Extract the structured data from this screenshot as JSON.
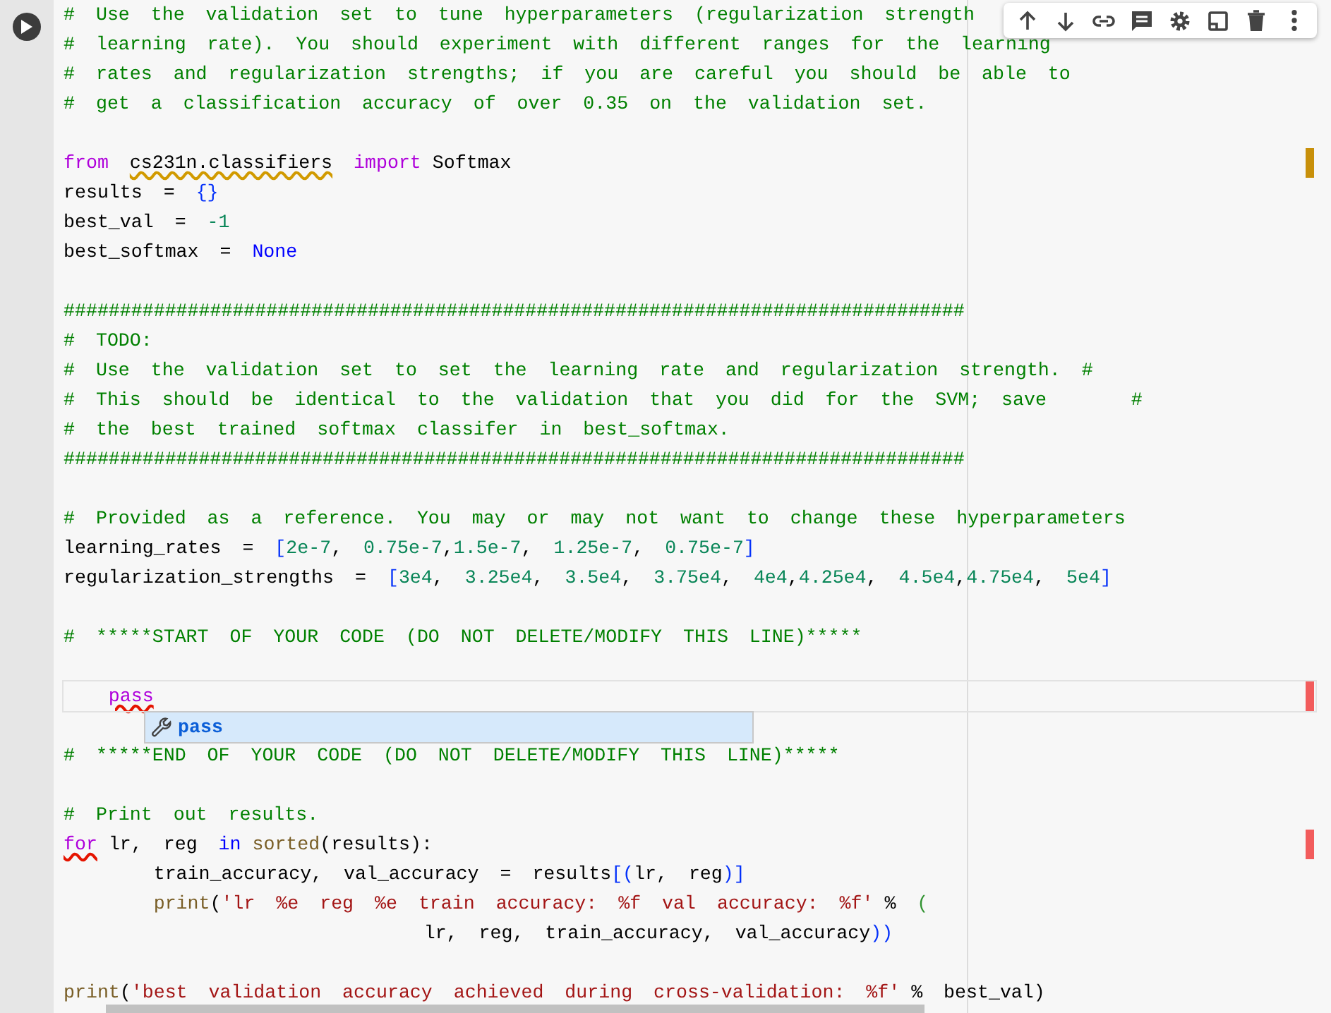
{
  "cell": {
    "lines": [
      {
        "kind": "code",
        "tokens": [
          {
            "t": "# Use the validation set to tune hyperparameters (regularization strength",
            "kind": "comment"
          }
        ]
      },
      {
        "kind": "code",
        "tokens": [
          {
            "t": "# learning rate). You should experiment with different ranges for the learning",
            "kind": "comment"
          }
        ]
      },
      {
        "kind": "code",
        "tokens": [
          {
            "t": "# rates and regularization strengths; if you are careful you should be able to",
            "kind": "comment"
          }
        ]
      },
      {
        "kind": "code",
        "tokens": [
          {
            "t": "# get a classification accuracy of over 0.35 on the validation set.",
            "kind": "comment"
          }
        ]
      },
      {
        "kind": "blank"
      },
      {
        "kind": "code",
        "marker": {
          "color": "#c8900a"
        },
        "tokens": [
          {
            "t": "from ",
            "kind": "keyword"
          },
          {
            "t": "cs231n.classifiers ",
            "kind": "plain",
            "squiggle": {
              "color": "#d19a00"
            }
          },
          {
            "t": "import",
            "kind": "keyword"
          },
          {
            "t": " Softmax",
            "kind": "plain"
          }
        ]
      },
      {
        "kind": "code",
        "tokens": [
          {
            "t": "results = ",
            "kind": "plain"
          },
          {
            "t": "{}",
            "kind": "bracket"
          }
        ]
      },
      {
        "kind": "code",
        "tokens": [
          {
            "t": "best_val = ",
            "kind": "plain"
          },
          {
            "t": "-1",
            "kind": "number"
          }
        ]
      },
      {
        "kind": "code",
        "tokens": [
          {
            "t": "best_softmax = ",
            "kind": "plain"
          },
          {
            "t": "None",
            "kind": "constant"
          }
        ]
      },
      {
        "kind": "blank"
      },
      {
        "kind": "code",
        "tokens": [
          {
            "t": "################################################################################",
            "kind": "comment"
          }
        ]
      },
      {
        "kind": "code",
        "tokens": [
          {
            "t": "# TODO:",
            "kind": "comment"
          }
        ]
      },
      {
        "kind": "code",
        "tokens": [
          {
            "t": "# Use the validation set to set the learning rate and regularization strength. #",
            "kind": "comment"
          }
        ]
      },
      {
        "kind": "code",
        "tokens": [
          {
            "t": "# This should be identical to the validation that you did for the SVM; save    #",
            "kind": "comment"
          }
        ]
      },
      {
        "kind": "code",
        "tokens": [
          {
            "t": "# the best trained softmax classifer in best_softmax.",
            "kind": "comment"
          }
        ]
      },
      {
        "kind": "code",
        "tokens": [
          {
            "t": "################################################################################",
            "kind": "comment"
          }
        ]
      },
      {
        "kind": "blank"
      },
      {
        "kind": "code",
        "tokens": [
          {
            "t": "# Provided as a reference. You may or may not want to change these hyperparameters",
            "kind": "comment"
          }
        ]
      },
      {
        "kind": "code",
        "tokens": [
          {
            "t": "learning_rates = ",
            "kind": "plain"
          },
          {
            "t": "[",
            "kind": "bracket"
          },
          {
            "t": "2e-7",
            "kind": "number"
          },
          {
            "t": ", ",
            "kind": "plain"
          },
          {
            "t": "0.75e-7",
            "kind": "number"
          },
          {
            "t": ",",
            "kind": "plain"
          },
          {
            "t": "1.5e-7",
            "kind": "number"
          },
          {
            "t": ", ",
            "kind": "plain"
          },
          {
            "t": "1.25e-7",
            "kind": "number"
          },
          {
            "t": ", ",
            "kind": "plain"
          },
          {
            "t": "0.75e-7",
            "kind": "number"
          },
          {
            "t": "]",
            "kind": "bracket"
          }
        ]
      },
      {
        "kind": "code",
        "tokens": [
          {
            "t": "regularization_strengths = ",
            "kind": "plain"
          },
          {
            "t": "[",
            "kind": "bracket"
          },
          {
            "t": "3e4",
            "kind": "number"
          },
          {
            "t": ", ",
            "kind": "plain"
          },
          {
            "t": "3.25e4",
            "kind": "number"
          },
          {
            "t": ", ",
            "kind": "plain"
          },
          {
            "t": "3.5e4",
            "kind": "number"
          },
          {
            "t": ", ",
            "kind": "plain"
          },
          {
            "t": "3.75e4",
            "kind": "number"
          },
          {
            "t": ", ",
            "kind": "plain"
          },
          {
            "t": "4e4",
            "kind": "number"
          },
          {
            "t": ",",
            "kind": "plain"
          },
          {
            "t": "4.25e4",
            "kind": "number"
          },
          {
            "t": ", ",
            "kind": "plain"
          },
          {
            "t": "4.5e4",
            "kind": "number"
          },
          {
            "t": ",",
            "kind": "plain"
          },
          {
            "t": "4.75e4",
            "kind": "number"
          },
          {
            "t": ", ",
            "kind": "plain"
          },
          {
            "t": "5e4",
            "kind": "number"
          },
          {
            "t": "]",
            "kind": "bracket"
          }
        ]
      },
      {
        "kind": "blank"
      },
      {
        "kind": "code",
        "tokens": [
          {
            "t": "# *****START OF YOUR CODE (DO NOT DELETE/MODIFY THIS LINE)*****",
            "kind": "comment"
          }
        ]
      },
      {
        "kind": "blank"
      },
      {
        "kind": "code",
        "current": true,
        "marker": {
          "color": "#f25c5c"
        },
        "tokens": [
          {
            "t": "    pass",
            "kind": "keyword",
            "squiggle": {
              "color": "#e51400"
            }
          }
        ]
      },
      {
        "kind": "blank"
      },
      {
        "kind": "code",
        "tokens": [
          {
            "t": "# *****END OF YOUR CODE (DO NOT DELETE/MODIFY THIS LINE)*****",
            "kind": "comment"
          }
        ]
      },
      {
        "kind": "blank"
      },
      {
        "kind": "code",
        "tokens": [
          {
            "t": "# Print out results.",
            "kind": "comment"
          }
        ]
      },
      {
        "kind": "code",
        "marker": {
          "color": "#f25c5c"
        },
        "tokens": [
          {
            "t": "for",
            "kind": "keyword",
            "squiggle": {
              "color": "#e51400"
            }
          },
          {
            "t": " lr, reg ",
            "kind": "plain"
          },
          {
            "t": "in",
            "kind": "constant"
          },
          {
            "t": " sorted",
            "kind": "function"
          },
          {
            "t": "(results):",
            "kind": "plain"
          }
        ]
      },
      {
        "kind": "code",
        "tokens": [
          {
            "t": "        train_accuracy, val_accuracy = results",
            "kind": "plain"
          },
          {
            "t": "[(",
            "kind": "bracket"
          },
          {
            "t": "lr, reg",
            "kind": "plain"
          },
          {
            "t": ")]",
            "kind": "bracket"
          }
        ]
      },
      {
        "kind": "code",
        "tokens": [
          {
            "t": "        print",
            "kind": "function"
          },
          {
            "t": "(",
            "kind": "plain"
          },
          {
            "t": "'lr %e reg %e train accuracy: %f val accuracy: %f'",
            "kind": "string"
          },
          {
            "t": " % ",
            "kind": "plain"
          },
          {
            "t": "(",
            "kind": "bracket2"
          }
        ]
      },
      {
        "kind": "code",
        "tokens": [
          {
            "t": "                                lr, reg, train_accuracy, val_accuracy",
            "kind": "plain"
          },
          {
            "t": "))",
            "kind": "bracket"
          }
        ]
      },
      {
        "kind": "blank"
      },
      {
        "kind": "code",
        "tokens": [
          {
            "t": "print",
            "kind": "function"
          },
          {
            "t": "(",
            "kind": "plain"
          },
          {
            "t": "'best validation accuracy achieved during cross-validation: %f'",
            "kind": "string"
          },
          {
            "t": " % best_val)",
            "kind": "plain"
          }
        ]
      }
    ],
    "autocomplete": {
      "items": [
        {
          "label": "pass",
          "selected": true
        }
      ]
    }
  }
}
